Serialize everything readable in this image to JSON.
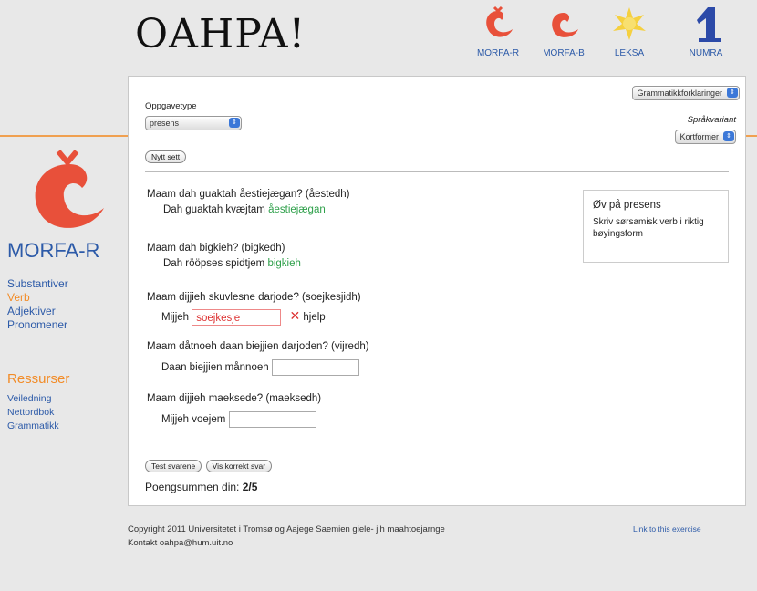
{
  "header": {
    "logo": "OAHPA!"
  },
  "topnav": [
    {
      "label": "MORFA-R"
    },
    {
      "label": "MORFA-B"
    },
    {
      "label": "LEKSA"
    },
    {
      "label": "NUMRA"
    }
  ],
  "sidebar": {
    "title": "MORFA-R",
    "links": [
      "Substantiver",
      "Verb",
      "Adjektiver",
      "Pronomener"
    ],
    "resources_title": "Ressurser",
    "resources": [
      "Veiledning",
      "Nettordbok",
      "Grammatikk"
    ]
  },
  "form": {
    "grammar_select": "Grammatikkforklaringer",
    "task_type_label": "Oppgavetype",
    "task_type_value": "presens",
    "language_variant_label": "Språkvariant",
    "language_variant_value": "Kortformer",
    "new_set_button": "Nytt sett"
  },
  "exercises": [
    {
      "question": "Maam dah guaktah åestiejægan? (åestedh)",
      "answer_prefix": "Dah guaktah kvæjtam",
      "answer": "åestiejægan"
    },
    {
      "question": "Maam dah bigkieh? (bigkedh)",
      "answer_prefix": "Dah rööpses spidtjem",
      "answer": "bigkieh"
    },
    {
      "question": "Maam dijjieh skuvlesne darjode? (soejkesjidh)",
      "answer_prefix": "Mijjeh",
      "answer": "soejkesje",
      "help": "hjelp"
    },
    {
      "question": "Maam dåtnoeh daan biejjien darjoden? (vijredh)",
      "answer_prefix": "Daan biejjien månnoeh",
      "answer": ""
    },
    {
      "question": "Maam dijjieh maeksede? (maeksedh)",
      "answer_prefix": "Mijjeh voejem",
      "answer": ""
    }
  ],
  "info_box": {
    "title": "Øv på presens",
    "text": "Skriv sørsamisk verb i riktig bøyingsform"
  },
  "actions": {
    "test_button": "Test svarene",
    "show_button": "Vis korrekt svar"
  },
  "score": {
    "label": "Poengsummen din:",
    "value": "2/5"
  },
  "footer": {
    "copyright": "Copyright 2011 Universitetet i Tromsø og Aajege Saemien giele- jih maahtoejarnge",
    "contact": "Kontakt oahpa@hum.uit.no",
    "link": "Link to this exercise"
  },
  "colors": {
    "accent_orange": "#f0a050",
    "link_blue": "#2c5aa8",
    "correct_green": "#2ea04a",
    "error_red": "#d33333"
  }
}
